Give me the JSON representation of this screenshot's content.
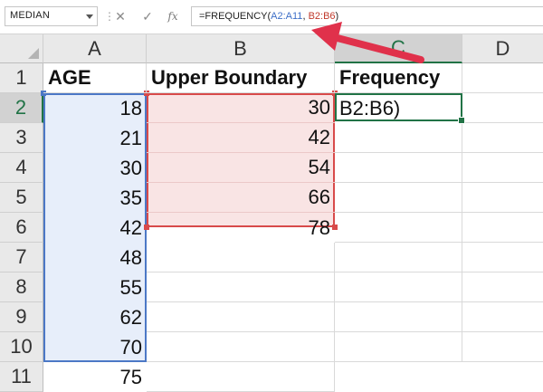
{
  "name_box": {
    "value": "MEDIAN"
  },
  "formula_bar": {
    "cancel_icon": "close-icon",
    "enter_icon": "check-icon",
    "fx_label": "fx",
    "prefix": "=FREQUENCY(",
    "ref1": "A2:A11",
    "sep": ", ",
    "ref2": "B2:B6",
    "suffix": ")"
  },
  "columns": [
    "A",
    "B",
    "C",
    "D"
  ],
  "rows": [
    "1",
    "2",
    "3",
    "4",
    "5",
    "6",
    "7",
    "8",
    "9",
    "10",
    "11"
  ],
  "headers": {
    "a": "AGE",
    "b": "Upper Boundary",
    "c": "Frequency"
  },
  "age_values": [
    "18",
    "21",
    "30",
    "35",
    "42",
    "48",
    "55",
    "62",
    "70",
    "75"
  ],
  "boundary_values": [
    "30",
    "42",
    "54",
    "66",
    "78"
  ],
  "active_cell_text": "B2:B6)",
  "colors": {
    "accent": "#217346",
    "ref_blue": "#4c78c6",
    "ref_red": "#d84a4a",
    "arrow": "#e0314b"
  }
}
